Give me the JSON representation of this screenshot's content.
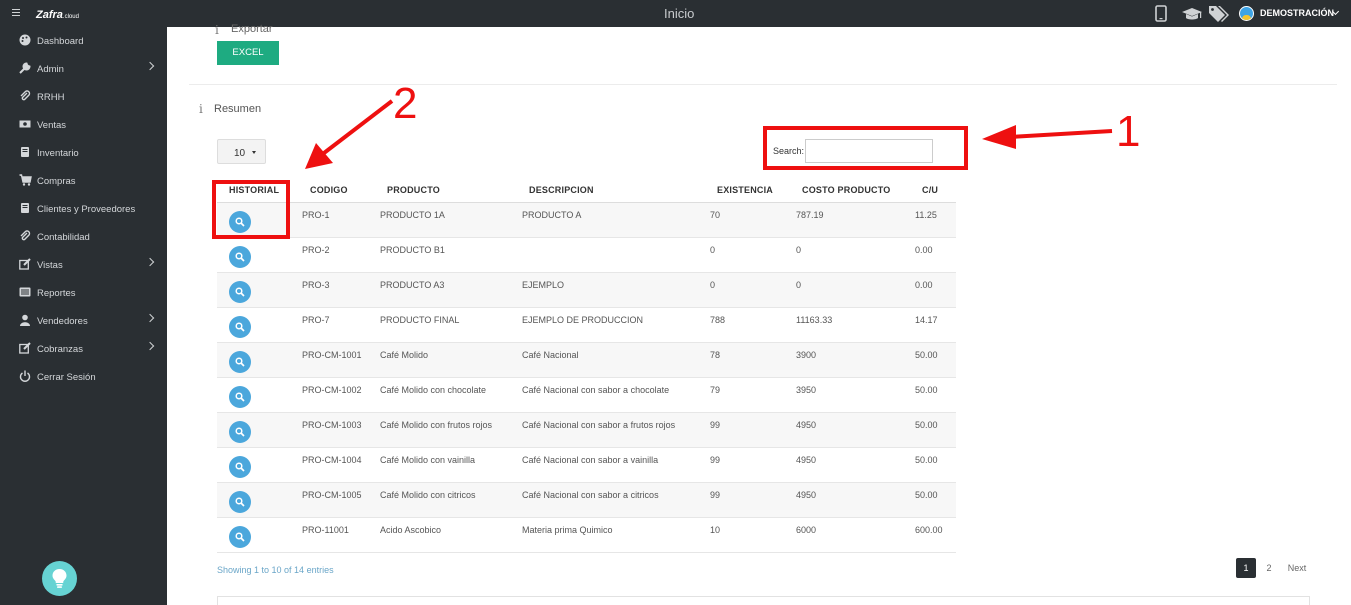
{
  "app": {
    "logo_text": "Zafra",
    "logo_suffix": ".cloud"
  },
  "sidebar": {
    "items": [
      {
        "label": "Dashboard",
        "icon": "palette-icon",
        "has_submenu": false
      },
      {
        "label": "Admin",
        "icon": "wrench-icon",
        "has_submenu": true
      },
      {
        "label": "RRHH",
        "icon": "paperclip-icon",
        "has_submenu": false
      },
      {
        "label": "Ventas",
        "icon": "money-icon",
        "has_submenu": false
      },
      {
        "label": "Inventario",
        "icon": "book-icon",
        "has_submenu": false
      },
      {
        "label": "Compras",
        "icon": "cart-icon",
        "has_submenu": false
      },
      {
        "label": "Clientes y Proveedores",
        "icon": "book-icon",
        "has_submenu": false
      },
      {
        "label": "Contabilidad",
        "icon": "paperclip-icon",
        "has_submenu": false
      },
      {
        "label": "Vistas",
        "icon": "edit-icon",
        "has_submenu": true
      },
      {
        "label": "Reportes",
        "icon": "list-icon",
        "has_submenu": false
      },
      {
        "label": "Vendedores",
        "icon": "user-icon",
        "has_submenu": true
      },
      {
        "label": "Cobranzas",
        "icon": "edit-icon",
        "has_submenu": true
      },
      {
        "label": "Cerrar Sesión",
        "icon": "power-icon",
        "has_submenu": false
      }
    ]
  },
  "topbar": {
    "title": "Inicio",
    "icons": [
      "mobile-icon",
      "graduation-cap-icon",
      "tags-icon"
    ],
    "user_name": "DEMOSTRACIÓN"
  },
  "export": {
    "label": "Exportar",
    "excel_button": "EXCEL"
  },
  "summary": {
    "title": "Resumen"
  },
  "table_controls": {
    "length_value": "10",
    "search_label": "Search:",
    "search_value": ""
  },
  "table": {
    "columns": [
      "HISTORIAL",
      "CODIGO",
      "PRODUCTO",
      "DESCRIPCION",
      "EXISTENCIA",
      "COSTO PRODUCTO",
      "C/U"
    ],
    "rows": [
      {
        "codigo": "PRO-1",
        "producto": "PRODUCTO 1A",
        "descripcion": "PRODUCTO A",
        "existencia": "70",
        "costo": "787.19",
        "cu": "11.25"
      },
      {
        "codigo": "PRO-2",
        "producto": "PRODUCTO B1",
        "descripcion": "",
        "existencia": "0",
        "costo": "0",
        "cu": "0.00"
      },
      {
        "codigo": "PRO-3",
        "producto": "PRODUCTO A3",
        "descripcion": "EJEMPLO",
        "existencia": "0",
        "costo": "0",
        "cu": "0.00"
      },
      {
        "codigo": "PRO-7",
        "producto": "PRODUCTO FINAL",
        "descripcion": "EJEMPLO DE PRODUCCION",
        "existencia": "788",
        "costo": "11163.33",
        "cu": "14.17"
      },
      {
        "codigo": "PRO-CM-1001",
        "producto": "Café Molido",
        "descripcion": "Café Nacional",
        "existencia": "78",
        "costo": "3900",
        "cu": "50.00"
      },
      {
        "codigo": "PRO-CM-1002",
        "producto": "Café Molido con chocolate",
        "descripcion": "Café Nacional con sabor a chocolate",
        "existencia": "79",
        "costo": "3950",
        "cu": "50.00"
      },
      {
        "codigo": "PRO-CM-1003",
        "producto": "Café Molido con frutos rojos",
        "descripcion": "Café Nacional con sabor a frutos rojos",
        "existencia": "99",
        "costo": "4950",
        "cu": "50.00"
      },
      {
        "codigo": "PRO-CM-1004",
        "producto": "Café Molido con vainilla",
        "descripcion": "Café Nacional con sabor a vainilla",
        "existencia": "99",
        "costo": "4950",
        "cu": "50.00"
      },
      {
        "codigo": "PRO-CM-1005",
        "producto": "Café Molido con citricos",
        "descripcion": "Café Nacional con sabor a citricos",
        "existencia": "99",
        "costo": "4950",
        "cu": "50.00"
      },
      {
        "codigo": "PRO-11001",
        "producto": "Acido Ascobico",
        "descripcion": "Materia prima Quimico",
        "existencia": "10",
        "costo": "6000",
        "cu": "600.00"
      }
    ]
  },
  "pagination": {
    "info": "Showing 1 to 10 of 14 entries",
    "pages": [
      "1",
      "2"
    ],
    "active_page": "1",
    "next_label": "Next"
  },
  "annotations": {
    "label_1": "1",
    "label_2": "2",
    "color": "#ee1010"
  }
}
